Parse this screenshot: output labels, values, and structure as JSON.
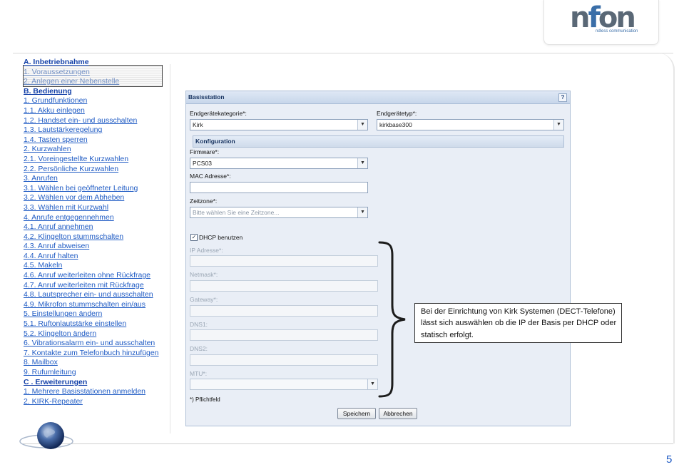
{
  "logo": {
    "text_n": "n",
    "text_f": "f",
    "text_on": "on",
    "tagline": "ndless communication"
  },
  "toc": [
    {
      "label": "A. Inbetriebnahme",
      "type": "head"
    },
    {
      "label": "1. Voraussetzungen",
      "type": "dim"
    },
    {
      "label": "2. Anlegen einer Nebenstelle",
      "type": "dim"
    },
    {
      "label": "B. Bedienung",
      "type": "head"
    },
    {
      "label": "1. Grundfunktionen",
      "type": "link"
    },
    {
      "label": "1.1. Akku einlegen",
      "type": "link"
    },
    {
      "label": "1.2. Handset ein- und ausschalten",
      "type": "link"
    },
    {
      "label": "1.3. Lautstärkeregelung",
      "type": "link"
    },
    {
      "label": "1.4. Tasten sperren",
      "type": "link"
    },
    {
      "label": "2. Kurzwahlen",
      "type": "link"
    },
    {
      "label": "2.1. Voreingestellte Kurzwahlen",
      "type": "link"
    },
    {
      "label": "2.2. Persönliche Kurzwahlen",
      "type": "link"
    },
    {
      "label": "3. Anrufen",
      "type": "link"
    },
    {
      "label": "3.1. Wählen bei geöffneter Leitung",
      "type": "link"
    },
    {
      "label": "3.2. Wählen vor dem Abheben",
      "type": "link"
    },
    {
      "label": "3.3. Wählen mit Kurzwahl",
      "type": "link"
    },
    {
      "label": "4. Anrufe entgegennehmen",
      "type": "link"
    },
    {
      "label": "4.1. Anruf annehmen",
      "type": "link"
    },
    {
      "label": "4.2. Klingelton stummschalten",
      "type": "link"
    },
    {
      "label": "4.3. Anruf abweisen",
      "type": "link"
    },
    {
      "label": "4.4. Anruf halten",
      "type": "link"
    },
    {
      "label": "4.5. Makeln",
      "type": "link"
    },
    {
      "label": "4.6. Anruf weiterleiten ohne Rückfrage",
      "type": "link"
    },
    {
      "label": "4.7. Anruf weiterleiten mit Rückfrage",
      "type": "link"
    },
    {
      "label": "4.8. Lautsprecher ein- und ausschalten",
      "type": "link"
    },
    {
      "label": "4.9. Mikrofon stummschalten ein/aus",
      "type": "link"
    },
    {
      "label": "5. Einstellungen ändern",
      "type": "link"
    },
    {
      "label": "5.1. Ruftonlautstärke einstellen",
      "type": "link"
    },
    {
      "label": "5.2. Klingelton ändern",
      "type": "link"
    },
    {
      "label": "6. Vibrationsalarm ein- und ausschalten",
      "type": "link"
    },
    {
      "label": "7. Kontakte zum Telefonbuch hinzufügen",
      "type": "link"
    },
    {
      "label": "8. Mailbox",
      "type": "link"
    },
    {
      "label": "9. Rufumleitung",
      "type": "link"
    },
    {
      "label": "C . Erweiterungen",
      "type": "head"
    },
    {
      "label": "1. Mehrere Basisstationen anmelden",
      "type": "link"
    },
    {
      "label": "2. KIRK-Repeater",
      "type": "link"
    }
  ],
  "form": {
    "title": "Basisstation",
    "help": "?",
    "category_label": "Endgerätekategorie*:",
    "category_value": "Kirk",
    "type_label": "Endgerätetyp*:",
    "type_value": "kirkbase300",
    "section": "Konfiguration",
    "firmware_label": "Firmware*:",
    "firmware_value": "PCS03",
    "mac_label": "MAC Adresse*:",
    "timezone_label": "Zeitzone*:",
    "timezone_placeholder": "Bitte wählen Sie eine Zeitzone...",
    "dhcp_label": "DHCP benutzen",
    "dhcp_checked": "✓",
    "ip_label": "IP Adresse*:",
    "netmask_label": "Netmask*:",
    "gateway_label": "Gateway*:",
    "dns1_label": "DNS1:",
    "dns2_label": "DNS2:",
    "mtu_label": "MTU*:",
    "required_note": "*) Pflichtfeld",
    "save_label": "Speichern",
    "cancel_label": "Abbrechen"
  },
  "callout": "Bei der Einrichtung von Kirk Systemen (DECT-Telefone) lässt sich auswählen ob die IP der Basis per DHCP oder statisch erfolgt.",
  "page_number": "5",
  "colors": {
    "link": "#1f5bc4",
    "panel_bg": "#e9eef6",
    "panel_border": "#aebfd6"
  }
}
